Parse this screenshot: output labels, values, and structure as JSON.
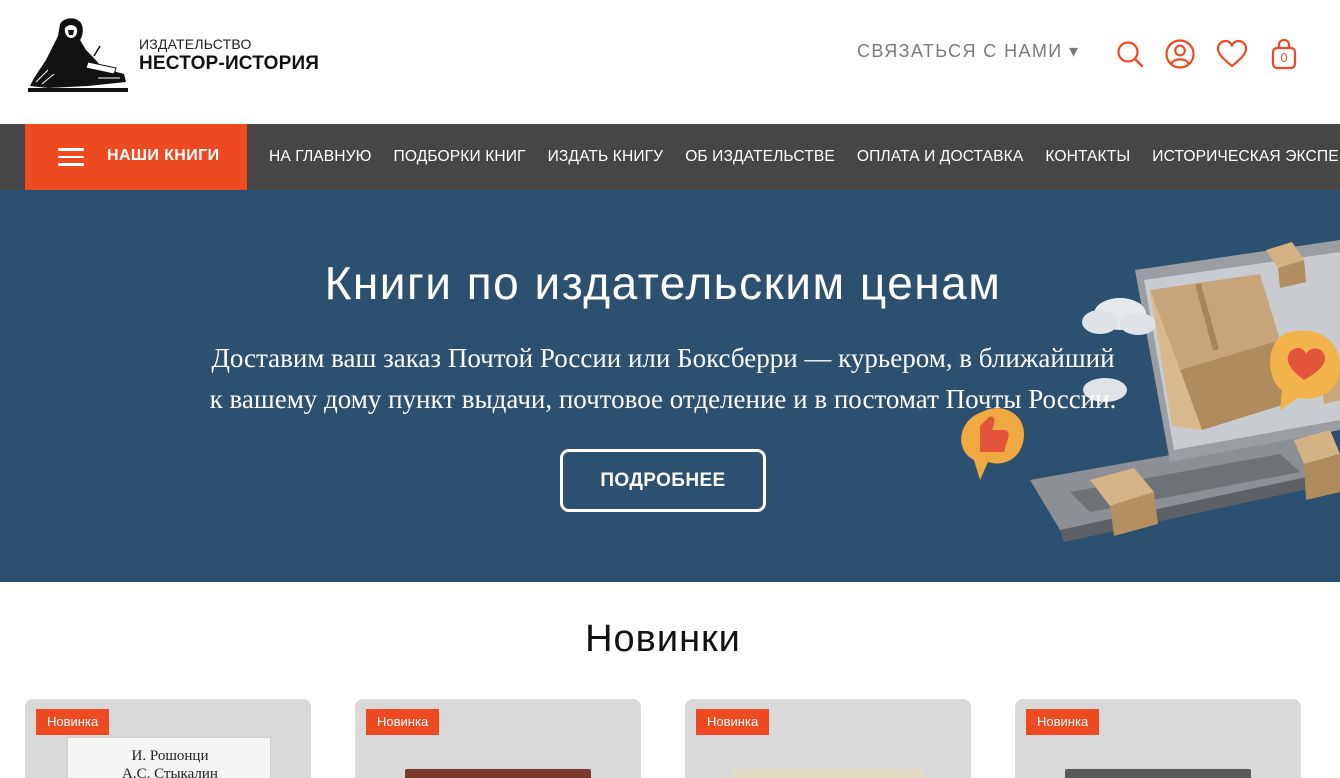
{
  "header": {
    "brand_small": "ИЗДАТЕЛЬСТВО",
    "brand_big": "НЕСТОР-ИСТОРИЯ",
    "contact_label": "СВЯЗАТЬСЯ С НАМИ ▾",
    "cart_count": "0",
    "icons": [
      "search-icon",
      "user-icon",
      "heart-icon",
      "shopping-bag-icon"
    ]
  },
  "nav": {
    "menu_label": "НАШИ КНИГИ",
    "links": [
      "НА ГЛАВНУЮ",
      "ПОДБОРКИ КНИГ",
      "ИЗДАТЬ КНИГУ",
      "ОБ ИЗДАТЕЛЬСТВЕ",
      "ОПЛАТА И ДОСТАВКА",
      "КОНТАКТЫ",
      "ИСТОРИЧЕСКАЯ ЭКСПЕРТИЗА"
    ]
  },
  "hero": {
    "title": "Книги по издательским ценам",
    "subtitle_line1": "Доставим ваш заказ Почтой России или Боксберри — курьером, в ближайший",
    "subtitle_line2": "к вашему дому пункт выдачи, почтовое отделение и в постомат Почты России.",
    "button_label": "ПОДРОБНЕЕ"
  },
  "new_section": {
    "title": "Новинки",
    "cards": [
      {
        "badge": "Новинка",
        "cover_line1": "И. Рошонци",
        "cover_line2": "А.С. Стыкалин"
      },
      {
        "badge": "Новинка"
      },
      {
        "badge": "Новинка"
      },
      {
        "badge": "Новинка"
      }
    ]
  },
  "colors": {
    "accent": "#ee4a22",
    "nav_bg": "#464646",
    "hero_bg": "#2c5070",
    "muted_text": "#7a7a7a"
  }
}
